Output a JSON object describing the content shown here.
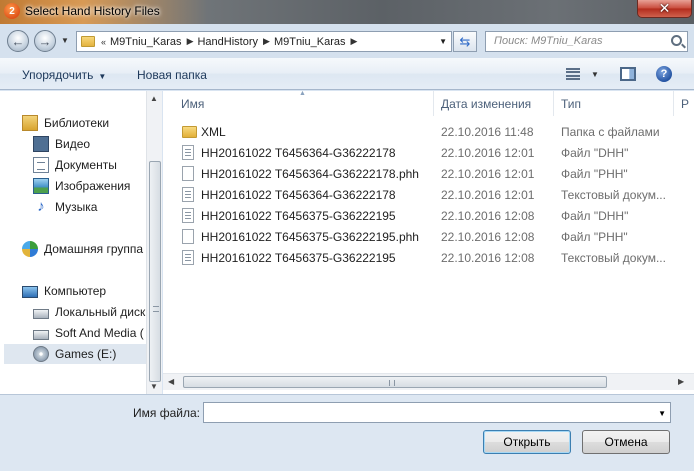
{
  "window": {
    "title": "Select Hand History Files",
    "app_icon_glyph": "2",
    "close_glyph": "✕"
  },
  "address": {
    "overflow": "«",
    "crumbs": [
      "M9Tniu_Karas",
      "HandHistory",
      "M9Tniu_Karas"
    ],
    "search_placeholder": "Поиск: M9Tniu_Karas"
  },
  "toolbar": {
    "organize_label": "Упорядочить",
    "new_folder_label": "Новая папка",
    "help_glyph": "?"
  },
  "sidebar": {
    "items": [
      {
        "label": "Библиотеки",
        "icon": "library-icon"
      },
      {
        "label": "Видео",
        "icon": "video-icon"
      },
      {
        "label": "Документы",
        "icon": "documents-icon"
      },
      {
        "label": "Изображения",
        "icon": "pictures-icon"
      },
      {
        "label": "Музыка",
        "icon": "music-icon"
      },
      {
        "label": "Домашняя группа",
        "icon": "homegroup-icon"
      },
      {
        "label": "Компьютер",
        "icon": "computer-icon"
      },
      {
        "label": "Локальный диск",
        "icon": "drive-icon"
      },
      {
        "label": "Soft And Media (",
        "icon": "drive-icon"
      },
      {
        "label": "Games (E:)",
        "icon": "dvd-drive-icon"
      }
    ],
    "selected_index": 9
  },
  "filelist": {
    "columns": {
      "name": "Имя",
      "date": "Дата изменения",
      "type": "Тип",
      "size": "Р"
    },
    "rows": [
      {
        "name": "XML",
        "date": "22.10.2016 11:48",
        "type": "Папка с файлами",
        "icon": "folder-icon"
      },
      {
        "name": "HH20161022 T6456364-G36222178",
        "date": "22.10.2016 12:01",
        "type": "Файл \"DHH\"",
        "icon": "text-file-icon"
      },
      {
        "name": "HH20161022 T6456364-G36222178.phh",
        "date": "22.10.2016 12:01",
        "type": "Файл \"PHH\"",
        "icon": "file-icon"
      },
      {
        "name": "HH20161022 T6456364-G36222178",
        "date": "22.10.2016 12:01",
        "type": "Текстовый докум...",
        "icon": "text-file-icon"
      },
      {
        "name": "HH20161022 T6456375-G36222195",
        "date": "22.10.2016 12:08",
        "type": "Файл \"DHH\"",
        "icon": "text-file-icon"
      },
      {
        "name": "HH20161022 T6456375-G36222195.phh",
        "date": "22.10.2016 12:08",
        "type": "Файл \"PHH\"",
        "icon": "file-icon"
      },
      {
        "name": "HH20161022 T6456375-G36222195",
        "date": "22.10.2016 12:08",
        "type": "Текстовый докум...",
        "icon": "text-file-icon"
      }
    ]
  },
  "bottom": {
    "filename_label": "Имя файла:",
    "filename_value": "",
    "open_label": "Открыть",
    "cancel_label": "Отмена"
  },
  "colors": {
    "window_frame": "#d9e4f1",
    "accent_link": "#1e395b",
    "close_button": "#c8493a"
  }
}
